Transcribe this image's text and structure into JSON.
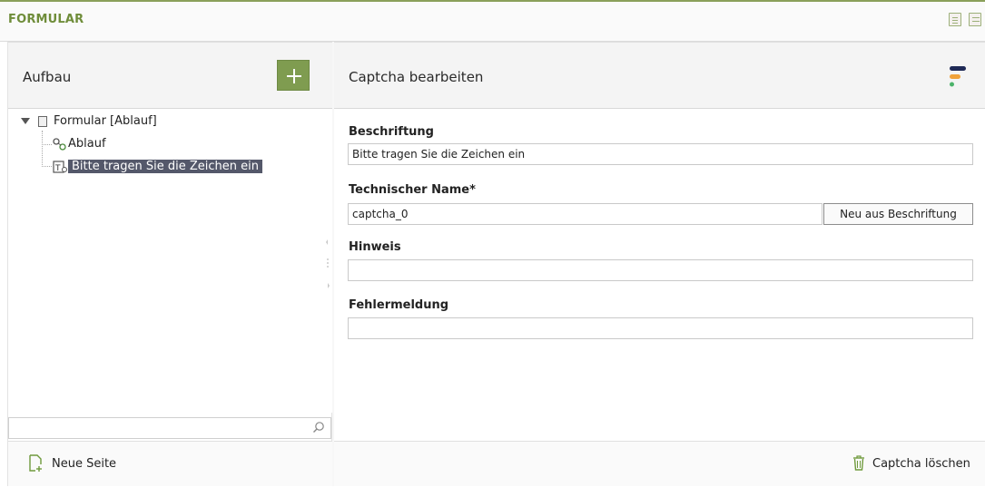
{
  "header": {
    "title": "FORMULAR"
  },
  "left_panel": {
    "title": "Aufbau",
    "add_icon": "plus-icon",
    "tree": [
      {
        "label": "Formular [Ablauf]",
        "icon": "form-document-icon",
        "expanded": true
      },
      {
        "label": "Ablauf",
        "icon": "workflow-icon"
      },
      {
        "label": "Bitte tragen Sie die Zeichen ein",
        "icon": "captcha-icon",
        "selected": true
      }
    ],
    "search": {
      "value": "",
      "placeholder": ""
    },
    "footer": {
      "new_page_label": "Neue Seite"
    }
  },
  "right_panel": {
    "title": "Captcha bearbeiten",
    "fields": {
      "caption": {
        "label": "Beschriftung",
        "value": "Bitte tragen Sie die Zeichen ein"
      },
      "technical_name": {
        "label": "Technischer Name*",
        "value": "captcha_0",
        "button": "Neu aus Beschriftung"
      },
      "hint": {
        "label": "Hinweis",
        "value": ""
      },
      "error_message": {
        "label": "Fehlermeldung",
        "value": ""
      }
    },
    "footer": {
      "delete_label": "Captcha löschen"
    }
  },
  "colors": {
    "accent": "#7f9c50",
    "title_green": "#6f8d3a",
    "selection": "#54586a",
    "brand_navy": "#1f2a56",
    "brand_orange": "#f0a23a",
    "brand_green": "#4cb36a"
  }
}
